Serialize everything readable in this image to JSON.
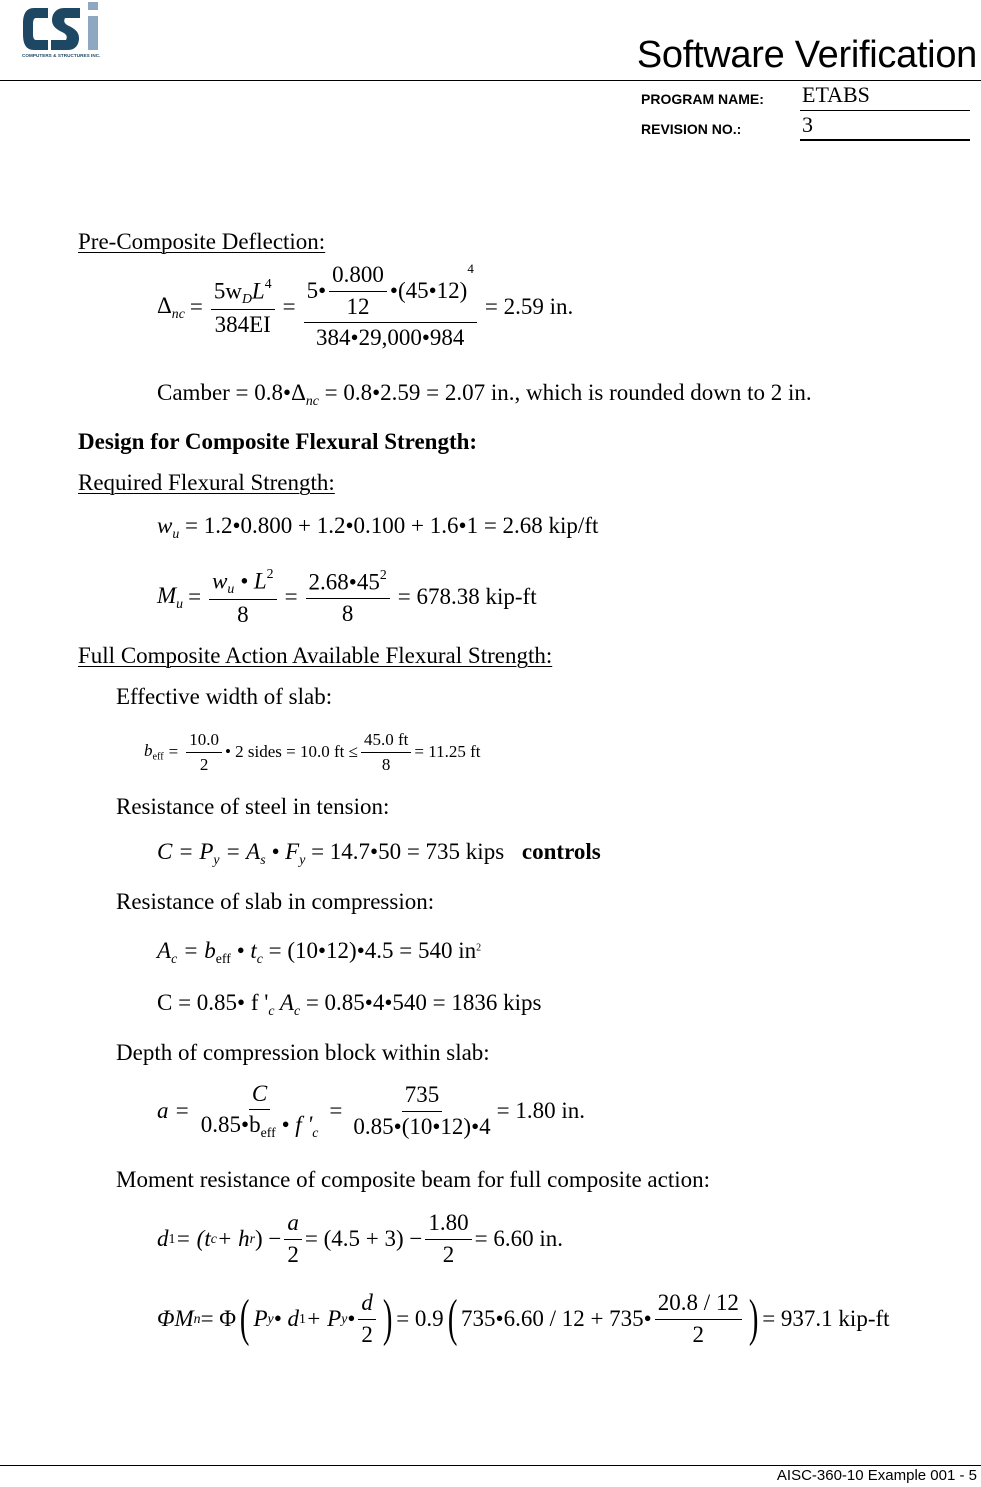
{
  "header": {
    "logo": {
      "name": "CSi",
      "tagline": "COMPUTERS & STRUCTURES INC.",
      "colors": {
        "dark": "#1e4763",
        "light": "#8fa8c2"
      }
    },
    "title": "Software Verification",
    "program_name_label": "PROGRAM NAME:",
    "program_name_value": "ETABS",
    "revision_label": "REVISION NO.:",
    "revision_value": "3"
  },
  "sections": {
    "pre_composite": {
      "heading": "Pre-Composite Deflection:",
      "deflection_eq": {
        "lhs": "Δ",
        "lhs_sub": "nc",
        "f1_num": "5w",
        "f1_num_sub": "D",
        "f1_num_L": "L",
        "f1_num_exp": "4",
        "f1_den": "384EI",
        "f2_num_a": "5•",
        "f2_inner_num": "0.800",
        "f2_inner_den": "12",
        "f2_num_b": "•(45•12)",
        "f2_num_exp": "4",
        "f2_den": "384•29,000•984",
        "result": "= 2.59 in."
      },
      "camber_eq": {
        "text_a": "Camber = 0.8•Δ",
        "sub": "nc",
        "text_b": " = 0.8•2.59 = 2.07 in., which is rounded down to 2 in."
      }
    },
    "design": {
      "heading": "Design for Composite Flexural Strength:"
    },
    "required": {
      "heading": "Required Flexural Strength:",
      "wu_eq": {
        "lhs": "w",
        "lhs_sub": "u",
        "rhs": " = 1.2•0.800 + 1.2•0.100 + 1.6•1 = 2.68 kip/ft"
      },
      "mu_eq": {
        "lhs": "M",
        "lhs_sub": "u",
        "f1_num_w": "w",
        "f1_num_w_sub": "u",
        "f1_num_rest": " • L",
        "f1_num_exp": "2",
        "f1_den": "8",
        "f2_num": "2.68•45",
        "f2_num_exp": "2",
        "f2_den": "8",
        "result": "= 678.38 kip-ft"
      }
    },
    "full_composite": {
      "heading": "Full Composite Action Available Flexural Strength:",
      "effective_width_label": "Effective width of slab:",
      "beff_eq": {
        "lhs": "b",
        "lhs_sub": "eff",
        "f1_num": "10.0",
        "f1_den": "2",
        "mid": "• 2 sides = 10.0 ft ≤",
        "f2_num": "45.0 ft",
        "f2_den": "8",
        "result": "= 11.25 ft"
      },
      "steel_tension_label": "Resistance of steel in tension:",
      "steel_eq": {
        "text": "C = P",
        "sub1": "y",
        "text2": " = A",
        "sub2": "s",
        "text3": " • F",
        "sub3": "y",
        "text4": " = 14.7•50 = 735 kips",
        "controls": "controls"
      },
      "slab_compression_label": "Resistance of slab in compression:",
      "ac_eq": {
        "a": "A",
        "a_sub": "c",
        "b": " = b",
        "b_sub": "eff",
        "c": " • t",
        "c_sub": "c",
        "d": " = (10•12)•4.5 = 540 in",
        "d_exp": "2"
      },
      "c_eq": {
        "a": "C = 0.85• f '",
        "a_sub": "c",
        "b": " A",
        "b_sub": "c",
        "c": " = 0.85•4•540 = 1836 kips"
      },
      "depth_label": "Depth of compression block within slab:",
      "a_eq": {
        "lhs": "a =",
        "f1_num": "C",
        "f1_den_a": "0.85•b",
        "f1_den_sub": "eff",
        "f1_den_b": " • f '",
        "f1_den_sub2": "c",
        "f2_num": "735",
        "f2_den": "0.85•(10•12)•4",
        "result": "= 1.80 in."
      },
      "moment_label": "Moment resistance of composite beam for full composite action:",
      "d1_eq": {
        "lhs": "d",
        "lhs_sub": "1",
        "p1": " = (t",
        "p1_sub": "c",
        "p2": " + h",
        "p2_sub": "r",
        "p3": ") −",
        "f1_num": "a",
        "f1_den": "2",
        "mid": "= (4.5 + 3) −",
        "f2_num": "1.80",
        "f2_den": "2",
        "result": "= 6.60 in."
      },
      "phimn_eq": {
        "lhs": "ΦM",
        "lhs_sub": "n",
        "eq1": " = Φ",
        "in1_a": "P",
        "in1_a_sub": "y",
        "in1_b": " • d",
        "in1_b_sub": "1",
        "in1_c": " + P",
        "in1_c_sub": "y",
        "in1_d": " •",
        "f1_num": "d",
        "f1_den": "2",
        "eq2": "= 0.9",
        "in2_a": "735•6.60 / 12 + 735•",
        "f2_num": "20.8 / 12",
        "f2_den": "2",
        "result": "= 937.1 kip-ft"
      }
    }
  },
  "footer": {
    "page_label": "AISC-360-10 Example 001 - 5"
  }
}
